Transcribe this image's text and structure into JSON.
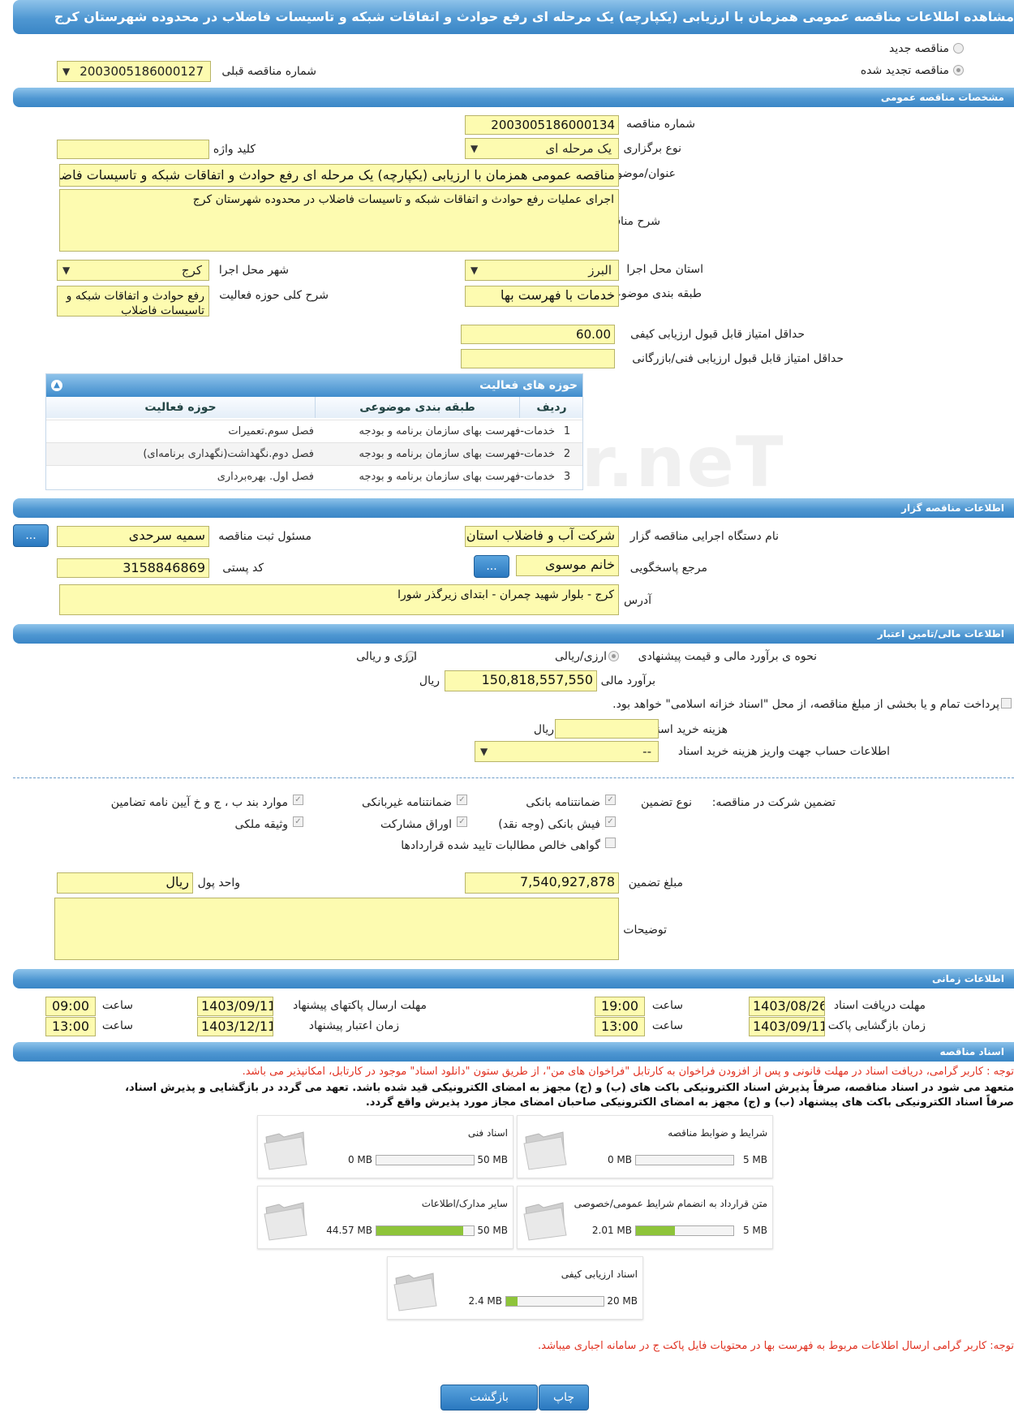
{
  "title": "مشاهده اطلاعات مناقصه عمومی همزمان با ارزیابی (یکپارچه) یک مرحله ای رفع حوادث و اتفاقات شبکه و تاسیسات فاضلاب در محدوده شهرستان کرج",
  "top": {
    "new_tender": "مناقصه جدید",
    "renewed_tender": "مناقصه تجدید شده",
    "prev_number_label": "شماره مناقصه قبلی",
    "prev_number": "2003005186000127"
  },
  "general": {
    "header": "مشخصات مناقصه عمومی",
    "number_label": "شماره مناقصه",
    "number": "2003005186000134",
    "type_label": "نوع برگزاری",
    "type": "یک مرحله ای",
    "keyword_label": "کلید واژه",
    "keyword": "",
    "subject_label": "عنوان/موضوع مناقصه",
    "subject": "مناقصه عمومی همزمان با ارزیابی (یکپارچه) یک مرحله ای رفع حوادث و اتفاقات شبکه و تاسیسات فاضلاب",
    "desc_label": "شرح مناقصه",
    "desc": "اجرای عملیات رفع حوادث و اتفاقات شبکه و تاسیسات فاضلاب در محدوده شهرستان کرج",
    "province_label": "استان محل اجرا",
    "province": "البرز",
    "city_label": "شهر محل اجرا",
    "city": "کرج",
    "category_label": "طبقه بندی موضوعی",
    "category": "خدمات با فهرست بها",
    "scope_label": "شرح کلی حوزه فعالیت",
    "scope": "رفع حوادث و اتفاقات شبکه و تاسیسات فاضلاب",
    "min_quality_label": "حداقل امتیاز قابل قبول ارزیابی کیفی",
    "min_quality": "60.00",
    "min_tech_label": "حداقل امتیاز قابل قبول ارزیابی فنی/بازرگانی",
    "min_tech": ""
  },
  "activities": {
    "title": "حوزه های فعالیت",
    "col_row": "ردیف",
    "col_category": "طبقه بندی موضوعی",
    "col_field": "حوزه فعالیت",
    "rows": [
      {
        "n": "1",
        "cat": "خدمات-فهرست بهای سازمان برنامه و بودجه",
        "field": "فصل سوم.تعمیرات"
      },
      {
        "n": "2",
        "cat": "خدمات-فهرست بهای سازمان برنامه و بودجه",
        "field": "فصل دوم.نگهداشت(نگهداری برنامه‌ای)"
      },
      {
        "n": "3",
        "cat": "خدمات-فهرست بهای سازمان برنامه و بودجه",
        "field": "فصل اول. بهره‌برداری"
      }
    ]
  },
  "organizer": {
    "header": "اطلاعات مناقصه گزار",
    "org_label": "نام دستگاه اجرایی مناقصه گزار",
    "org": "شرکت آب و فاضلاب استان",
    "resp_label": "مسئول ثبت مناقصه",
    "resp": "سمیه سرحدی",
    "ref_label": "مرجع پاسخگویی",
    "ref": "خانم موسوی",
    "postal_label": "کد پستی",
    "postal": "3158846869",
    "address_label": "آدرس",
    "address": "کرج - بلوار شهید چمران - ابتدای زیرگذر شورا",
    "dots": "..."
  },
  "finance": {
    "header": "اطلاعات مالی/تامین اعتبار",
    "method_label": "نحوه ی برآورد مالی و قیمت پیشنهادی",
    "opt1": "ارزی/ریالی",
    "opt2": "ارزی و ریالی",
    "estimate_label": "برآورد مالی",
    "estimate": "150,818,557,550",
    "rial": "ریال",
    "treasury": "پرداخت تمام و یا بخشی از مبلغ مناقصه، از محل \"اسناد خزانه اسلامی\" خواهد بود.",
    "doc_cost_label": "هزینه خرید اسناد",
    "doc_cost": "",
    "doc_cost_unit": "ریال",
    "account_label": "اطلاعات حساب جهت واریز هزینه خرید اسناد",
    "account": "--"
  },
  "guarantee": {
    "label": "تضمین شرکت در مناقصه:",
    "type_label": "نوع تضمین",
    "items": [
      "ضمانتنامه بانکی",
      "ضمانتنامه غیربانکی",
      "موارد بند ب ، ج و خ آیین نامه تضامین",
      "فیش بانکی (وجه نقد)",
      "اوراق مشارکت",
      "وثیقه ملکی",
      "گواهی خالص مطالبات تایید شده قراردادها"
    ],
    "amount_label": "مبلغ تضمین",
    "amount": "7,540,927,878",
    "unit_label": "واحد پول",
    "unit": "ریال",
    "notes_label": "توضیحات",
    "notes": ""
  },
  "time": {
    "header": "اطلاعات زمانی",
    "doc_get_label": "مهلت دریافت اسناد",
    "doc_get": "1403/08/26",
    "t1_label": "ساعت",
    "t1": "19:00",
    "send_label": "مهلت ارسال پاکتهای پیشنهاد",
    "send": "1403/09/11",
    "t2_label": "ساعت",
    "t2": "09:00",
    "open_label": "زمان بازگشایی پاکت ها",
    "open": "1403/09/11",
    "t3_label": "ساعت",
    "t3": "13:00",
    "valid_label": "زمان اعتبار پیشنهاد",
    "valid": "1403/12/11",
    "t4_label": "ساعت",
    "t4": "13:00"
  },
  "docs": {
    "header": "اسناد مناقصه",
    "note1": "توجه : کاربر گرامی، دریافت اسناد در مهلت قانونی و پس از افزودن فراخوان به کارتابل \"فراخوان های من\"، از طریق ستون \"دانلود اسناد\" موجود در کارتابل، امکانپذیر می باشد.",
    "commit1": "متعهد می شود در اسناد مناقصه، صرفاً پذیرش اسناد الکترونیکی باکت های (ب) و (ج) مجهز به امضای الکترونیکی قید شده باشد. تعهد می گردد در بازگشایی و پذیرش اسناد،",
    "commit2": "صرفاً اسناد الکترونیکی باکت های پیشنهاد (ب) و (ج) مجهز به امضای الکترونیکی صاحبان امضای مجاز مورد پذیرش واقع گردد.",
    "tiles": [
      {
        "name": "شرایط و ضوابط مناقصه",
        "used": "0 MB",
        "max": "5 MB",
        "fill": 0
      },
      {
        "name": "اسناد فنی",
        "used": "0 MB",
        "max": "50 MB",
        "fill": 0
      },
      {
        "name": "متن قرارداد به انضمام شرایط عمومی/خصوصی",
        "used": "2.01 MB",
        "max": "5 MB",
        "fill": 0.402
      },
      {
        "name": "سایر مدارک/اطلاعات",
        "used": "44.57 MB",
        "max": "50 MB",
        "fill": 0.891
      },
      {
        "name": "اسناد ارزیابی کیفی",
        "used": "2.4 MB",
        "max": "20 MB",
        "fill": 0.12
      }
    ],
    "note2": "توجه: کاربر گرامی ارسال اطلاعات مربوط به فهرست بها در محتویات فایل پاکت ج در سامانه اجباری میباشد."
  },
  "buttons": {
    "print": "چاپ",
    "back": "بازگشت"
  },
  "watermark": "ariatender.neT"
}
